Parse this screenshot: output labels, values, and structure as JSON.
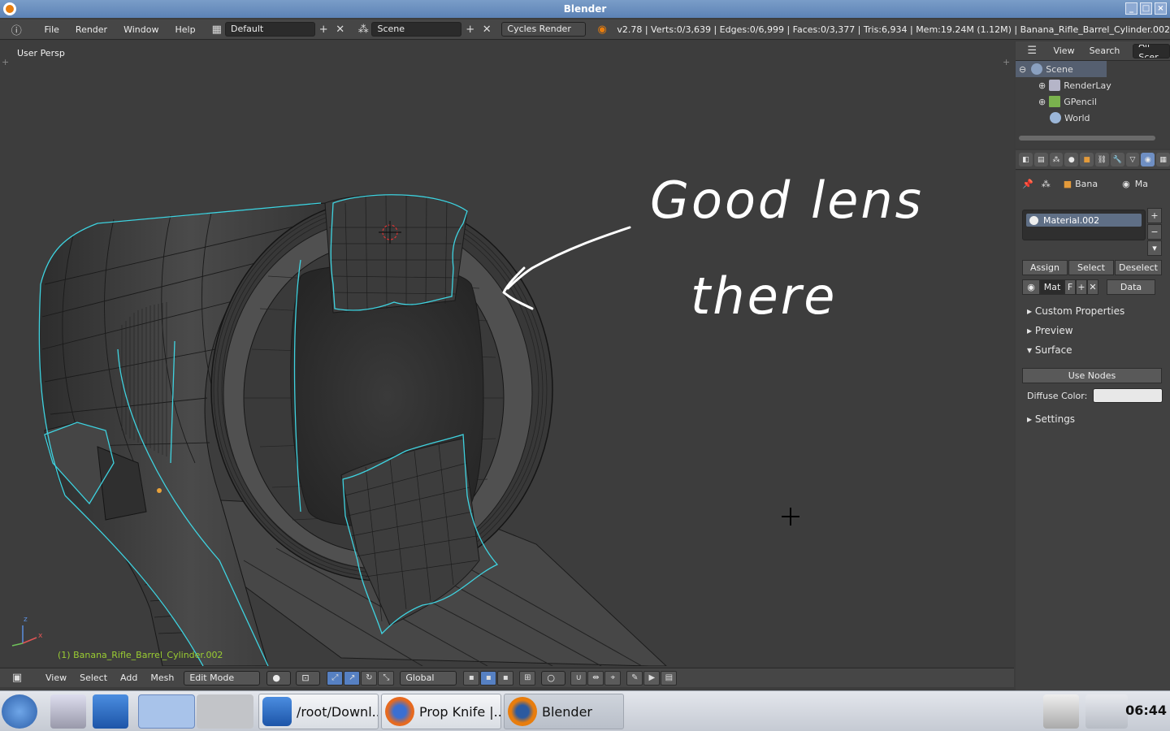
{
  "window": {
    "title": "Blender"
  },
  "info_header": {
    "menus": [
      "File",
      "Render",
      "Window",
      "Help"
    ],
    "layout": "Default",
    "scene": "Scene",
    "engine": "Cycles Render",
    "stats": "v2.78 | Verts:0/3,639 | Edges:0/6,999 | Faces:0/3,377 | Tris:6,934 | Mem:19.24M (1.12M) | Banana_Rifle_Barrel_Cylinder.002"
  },
  "viewport": {
    "view_name": "User Persp",
    "object_label": "(1) Banana_Rifle_Barrel_Cylinder.002",
    "annotation_line1": "Good lens",
    "annotation_line2": "there",
    "axis_x": "x",
    "axis_z": "z"
  },
  "view3d_header": {
    "menus": [
      "View",
      "Select",
      "Add",
      "Mesh"
    ],
    "mode": "Edit Mode",
    "orientation": "Global"
  },
  "outliner": {
    "header_view": "View",
    "header_search": "Search",
    "header_filter": "All Scer",
    "items": [
      {
        "label": "Scene"
      },
      {
        "label": "RenderLay"
      },
      {
        "label": "GPencil"
      },
      {
        "label": "World"
      }
    ]
  },
  "properties": {
    "context_object": "Bana",
    "context_material": "Ma",
    "material_slot": "Material.002",
    "assign": "Assign",
    "select": "Select",
    "deselect": "Deselect",
    "mat_field": "Mat",
    "fake_user": "F",
    "link": "Data",
    "sections": [
      "Custom Properties",
      "Preview",
      "Surface",
      "Settings"
    ],
    "use_nodes": "Use Nodes",
    "diffuse_label": "Diffuse Color:",
    "diffuse_color": "#e8e8e8"
  },
  "taskbar": {
    "tasks": [
      "/root/Downl...",
      "Prop Knife |...",
      "Blender"
    ],
    "clock": "06:44"
  },
  "colors": {
    "selection_edge": "#3fd3e0",
    "annotation": "#ffffff",
    "object_label": "#9acd32"
  }
}
